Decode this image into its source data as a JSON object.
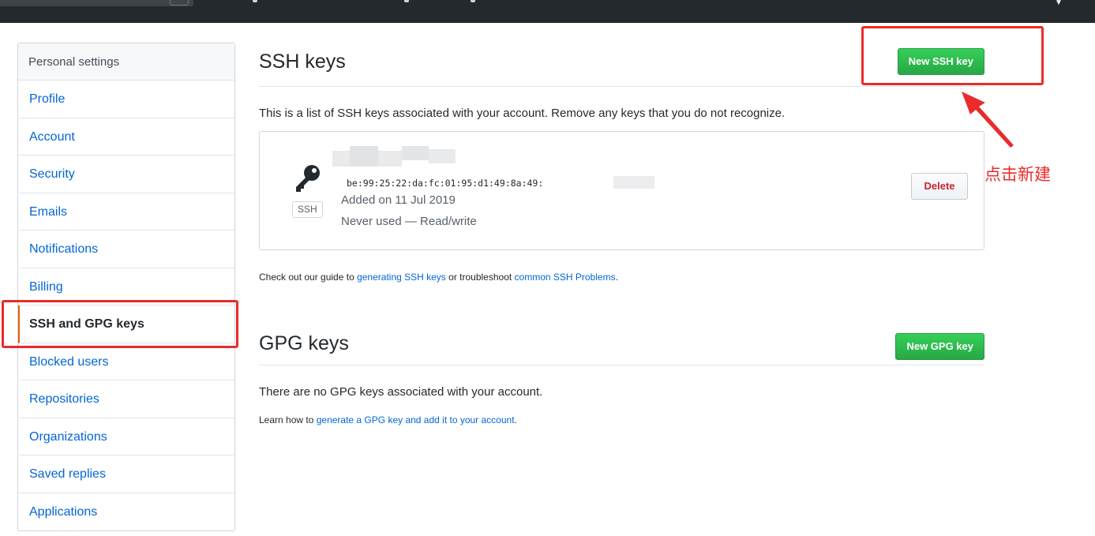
{
  "colors": {
    "accent_link": "#0366d6",
    "green_button": "#28a745",
    "danger": "#cb2431",
    "annotation": "#ea2b2b",
    "selected_bar": "#e36209"
  },
  "sidebar": {
    "heading": "Personal settings",
    "items": [
      {
        "label": "Profile",
        "selected": false
      },
      {
        "label": "Account",
        "selected": false
      },
      {
        "label": "Security",
        "selected": false
      },
      {
        "label": "Emails",
        "selected": false
      },
      {
        "label": "Notifications",
        "selected": false
      },
      {
        "label": "Billing",
        "selected": false
      },
      {
        "label": "SSH and GPG keys",
        "selected": true
      },
      {
        "label": "Blocked users",
        "selected": false
      },
      {
        "label": "Repositories",
        "selected": false
      },
      {
        "label": "Organizations",
        "selected": false
      },
      {
        "label": "Saved replies",
        "selected": false
      },
      {
        "label": "Applications",
        "selected": false
      }
    ]
  },
  "ssh": {
    "title": "SSH keys",
    "new_button": "New SSH key",
    "description": "This is a list of SSH keys associated with your account. Remove any keys that you do not recognize.",
    "key": {
      "icon": "key-icon",
      "badge": "SSH",
      "fingerprint": "be:99:25:22:da:fc:01:95:d1:49:8a:49:",
      "added": "Added on 11 Jul 2019",
      "usage": "Never used — Read/write",
      "delete_button": "Delete"
    },
    "help": {
      "prefix": "Check out our guide to ",
      "link1": "generating SSH keys",
      "middle": " or troubleshoot ",
      "link2": "common SSH Problems",
      "suffix": "."
    }
  },
  "gpg": {
    "title": "GPG keys",
    "new_button": "New GPG key",
    "empty_text": "There are no GPG keys associated with your account.",
    "help": {
      "prefix": "Learn how to ",
      "link": "generate a GPG key and add it to your account",
      "suffix": "."
    }
  },
  "annotation": {
    "text": "点击新建"
  }
}
